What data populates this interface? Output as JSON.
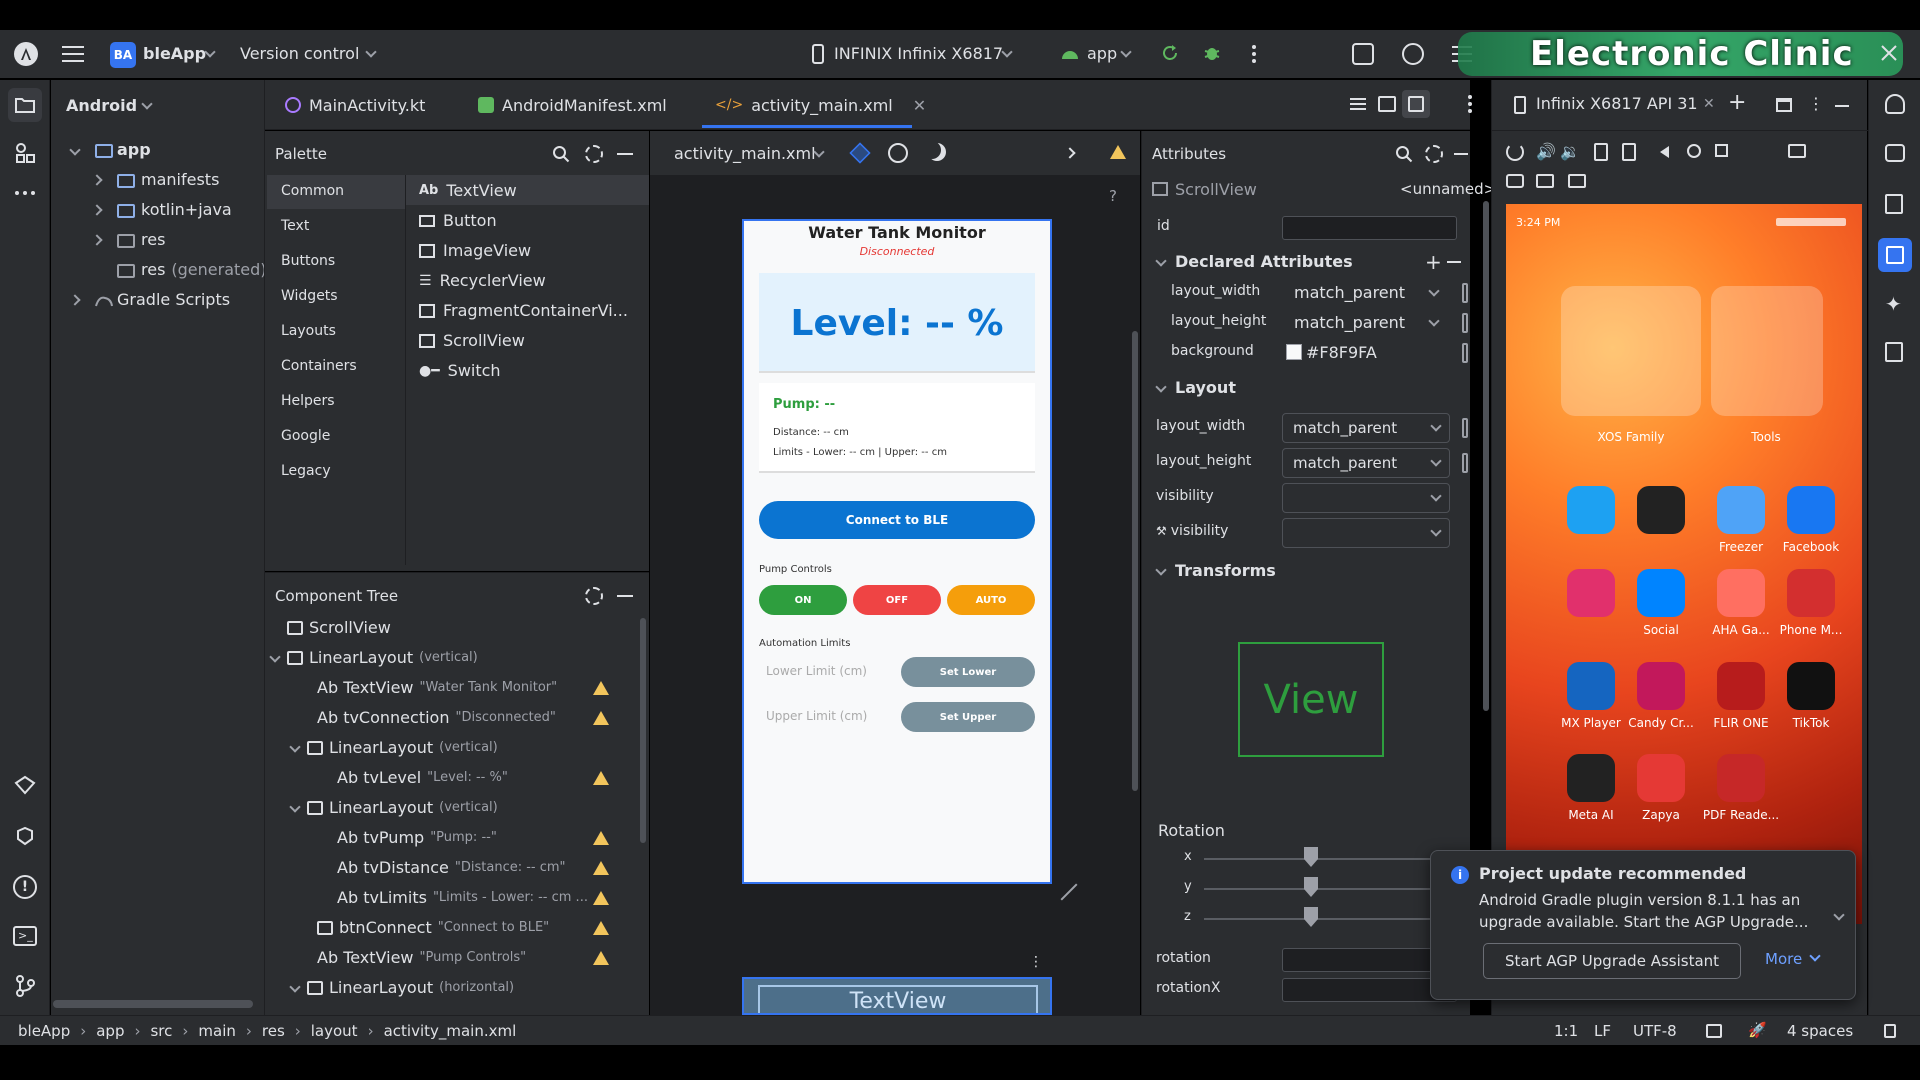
{
  "topbar": {
    "project_badge": "BA",
    "project_name": "bleApp",
    "version_control": "Version control",
    "device": "INFINIX Infinix X6817",
    "run_config": "app",
    "watermark": "Electronic Clinic"
  },
  "editor_tabs": [
    {
      "label": "MainActivity.kt"
    },
    {
      "label": "AndroidManifest.xml"
    },
    {
      "label": "activity_main.xml"
    }
  ],
  "project": {
    "view_label": "Android",
    "tree": [
      {
        "label": "app"
      },
      {
        "label": "manifests"
      },
      {
        "label": "kotlin+java"
      },
      {
        "label": "res"
      },
      {
        "label": "res",
        "suffix": "(generated)"
      },
      {
        "label": "Gradle Scripts"
      }
    ]
  },
  "palette": {
    "title": "Palette",
    "categories": [
      "Common",
      "Text",
      "Buttons",
      "Widgets",
      "Layouts",
      "Containers",
      "Helpers",
      "Google",
      "Legacy"
    ],
    "items": [
      "TextView",
      "Button",
      "ImageView",
      "RecyclerView",
      "FragmentContainerVi...",
      "ScrollView",
      "Switch"
    ]
  },
  "component_tree": {
    "title": "Component Tree",
    "nodes": [
      {
        "label": "ScrollView",
        "hint": ""
      },
      {
        "label": "LinearLayout",
        "hint": "(vertical)"
      },
      {
        "label": "Ab TextView",
        "hint": "\"Water Tank Monitor\""
      },
      {
        "label": "Ab tvConnection",
        "hint": "\"Disconnected\""
      },
      {
        "label": "LinearLayout",
        "hint": "(vertical)"
      },
      {
        "label": "Ab tvLevel",
        "hint": "\"Level: -- %\""
      },
      {
        "label": "LinearLayout",
        "hint": "(vertical)"
      },
      {
        "label": "Ab tvPump",
        "hint": "\"Pump: --\""
      },
      {
        "label": "Ab tvDistance",
        "hint": "\"Distance: -- cm\""
      },
      {
        "label": "Ab tvLimits",
        "hint": "\"Limits - Lower: -- cm ..."
      },
      {
        "label": "btnConnect",
        "hint": "\"Connect to BLE\""
      },
      {
        "label": "Ab TextView",
        "hint": "\"Pump Controls\""
      },
      {
        "label": "LinearLayout",
        "hint": "(horizontal)"
      }
    ]
  },
  "design": {
    "file_label": "activity_main.xml",
    "title": "Water Tank Monitor",
    "status": "Disconnected",
    "level": "Level: -- %",
    "pump": "Pump: --",
    "distance": "Distance: -- cm",
    "limits": "Limits - Lower: -- cm | Upper: -- cm",
    "connect": "Connect to BLE",
    "pump_controls": "Pump Controls",
    "on": "ON",
    "off": "OFF",
    "auto": "AUTO",
    "automation_limits": "Automation Limits",
    "lower_placeholder": "Lower Limit (cm)",
    "upper_placeholder": "Upper Limit (cm)",
    "set_lower": "Set Lower",
    "set_upper": "Set Upper",
    "preview_textview": "TextView"
  },
  "attributes": {
    "title": "Attributes",
    "component": "ScrollView",
    "unnamed": "<unnamed>",
    "id_label": "id",
    "declared_header": "Declared Attributes",
    "declared": [
      {
        "name": "layout_width",
        "value": "match_parent"
      },
      {
        "name": "layout_height",
        "value": "match_parent"
      },
      {
        "name": "background",
        "value": "#F8F9FA"
      }
    ],
    "layout_header": "Layout",
    "layout": [
      {
        "name": "layout_width",
        "value": "match_parent"
      },
      {
        "name": "layout_height",
        "value": "match_parent"
      },
      {
        "name": "visibility",
        "value": ""
      },
      {
        "name": "visibility",
        "value": ""
      }
    ],
    "transforms_header": "Transforms",
    "view_preview": "View",
    "rotation_header": "Rotation",
    "axes": [
      "x",
      "y",
      "z"
    ],
    "fields": [
      "rotation",
      "rotationX"
    ]
  },
  "running_device": {
    "tab": "Infinix X6817 API 31",
    "time": "3:24 PM",
    "folders": [
      {
        "label": "XOS Family"
      },
      {
        "label": "Tools"
      }
    ],
    "apps": [
      {
        "label": ""
      },
      {
        "label": ""
      },
      {
        "label": "Freezer"
      },
      {
        "label": "Facebook"
      },
      {
        "label": ""
      },
      {
        "label": "Social"
      },
      {
        "label": "AHA Ga..."
      },
      {
        "label": "Phone M..."
      },
      {
        "label": "MX Player"
      },
      {
        "label": "Candy Cr..."
      },
      {
        "label": "FLIR ONE"
      },
      {
        "label": "TikTok"
      },
      {
        "label": "Meta AI"
      },
      {
        "label": "Zapya"
      },
      {
        "label": "PDF Reade..."
      }
    ]
  },
  "notification": {
    "title": "Project update recommended",
    "body": "Android Gradle plugin version 8.1.1 has an upgrade available. Start the AGP Upgrade...",
    "button": "Start AGP Upgrade Assistant",
    "more": "More"
  },
  "statusbar": {
    "breadcrumb": [
      "bleApp",
      "app",
      "src",
      "main",
      "res",
      "layout",
      "activity_main.xml"
    ],
    "position": "1:1",
    "line_ending": "LF",
    "encoding": "UTF-8",
    "indent": "4 spaces"
  },
  "colors": {
    "ide_bg": "#2b2d30",
    "accent": "#3574f0",
    "green": "#2e9e3e",
    "red": "#ef4444",
    "amber": "#f59e0b",
    "ble_blue": "#0b74d1"
  }
}
